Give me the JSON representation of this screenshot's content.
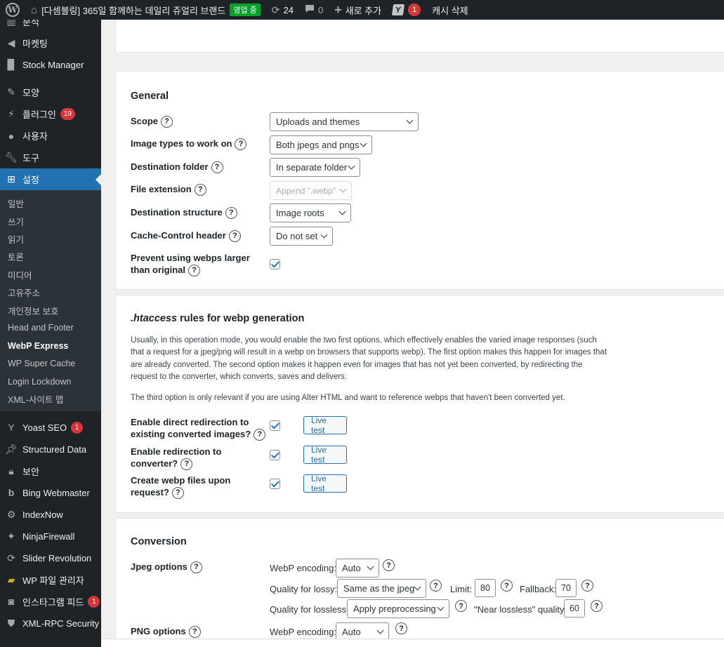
{
  "adminbar": {
    "site_name": "[다셈블링] 365일 함께하는 데일리 쥬얼리 브랜드",
    "live_badge": "영업 중",
    "updates_count": "24",
    "comments_count": "0",
    "new_label": "새로 추가",
    "yoast_count": "1",
    "cache_label": "캐시 삭제"
  },
  "sidebar": {
    "items_top": [
      {
        "label": "분석",
        "icon": "chart-icon"
      },
      {
        "label": "마켓팅",
        "icon": "megaphone-icon"
      },
      {
        "label": "Stock Manager",
        "icon": "book-icon"
      },
      {
        "label": "모양",
        "icon": "brush-icon"
      },
      {
        "label": "플러그인",
        "icon": "plugin-icon",
        "badge": "19"
      },
      {
        "label": "사용자",
        "icon": "user-icon"
      },
      {
        "label": "도구",
        "icon": "wrench-icon"
      },
      {
        "label": "설정",
        "icon": "settings-icon"
      }
    ],
    "submenu": [
      "일반",
      "쓰기",
      "읽기",
      "토론",
      "미디어",
      "고유주소",
      "개인정보 보호",
      "Head and Footer",
      "WebP Express",
      "WP Super Cache",
      "Login Lockdown",
      "XML-사이트 맵"
    ],
    "items_bottom": [
      {
        "label": "Yoast SEO",
        "icon": "yoast-icon",
        "badge": "1"
      },
      {
        "label": "Structured Data",
        "icon": "pin-icon"
      },
      {
        "label": "보안",
        "icon": "lock-icon"
      },
      {
        "label": "Bing Webmaster",
        "icon": "bing-icon"
      },
      {
        "label": "IndexNow",
        "icon": "gear-icon"
      },
      {
        "label": "NinjaFirewall",
        "icon": "ninja-icon"
      },
      {
        "label": "Slider Revolution",
        "icon": "refresh-icon"
      },
      {
        "label": "WP 파일 관리자",
        "icon": "folder-icon"
      },
      {
        "label": "인스타그램 피드",
        "icon": "camera-icon",
        "badge": "1"
      },
      {
        "label": "XML-RPC Security",
        "icon": "shield-icon"
      }
    ]
  },
  "general": {
    "heading": "General",
    "scope_label": "Scope",
    "scope_value": "Uploads and themes",
    "image_types_label": "Image types to work on",
    "image_types_value": "Both jpegs and pngs",
    "dest_folder_label": "Destination folder",
    "dest_folder_value": "In separate folder",
    "file_ext_label": "File extension",
    "file_ext_value": "Append \".webp\"",
    "dest_struct_label": "Destination structure",
    "dest_struct_value": "Image roots",
    "cache_control_label": "Cache-Control header",
    "cache_control_value": "Do not set",
    "prevent_label_1": "Prevent using webps larger",
    "prevent_label_2": "than original"
  },
  "htaccess": {
    "heading_em": ".htaccess",
    "heading_rest": " rules for webp generation",
    "para1": "Usually, in this operation mode, you would enable the two first options, which effectively enables the varied image responses (such that a request for a jpeg/png will result in a webp on browsers that supports webp). The first option makes this happen for images that are already converted. The second option makes it happen even for images that has not yet been converted, by redirecting the request to the converter, which converts, saves and delivers.",
    "para2": "The third option is only relevant if you are using Alter HTML and want to reference webps that haven't been converted yet.",
    "opt1_line1": "Enable direct redirection to",
    "opt1_line2": "existing converted images?",
    "opt2_line1": "Enable redirection to",
    "opt2_line2": "converter?",
    "opt3_line1": "Create webp files upon",
    "opt3_line2": "request?",
    "live_test": "Live test"
  },
  "conversion": {
    "heading": "Conversion",
    "jpeg_label": "Jpeg options",
    "webp_encoding_label": "WebP encoding:",
    "webp_encoding_value": "Auto",
    "quality_lossy_label": "Quality for lossy:",
    "quality_lossy_value": "Same as the jpeg",
    "limit_label": "Limit:",
    "limit_value": "80",
    "fallback_label": "Fallback:",
    "fallback_value": "70",
    "quality_lossless_label": "Quality for lossless:",
    "quality_lossless_value": "Apply preprocessing",
    "near_lossless_label": "\"Near lossless\" quality:",
    "near_lossless_value": "60",
    "png_label": "PNG options",
    "png_webp_encoding_label": "WebP encoding:",
    "png_webp_encoding_value": "Auto"
  }
}
